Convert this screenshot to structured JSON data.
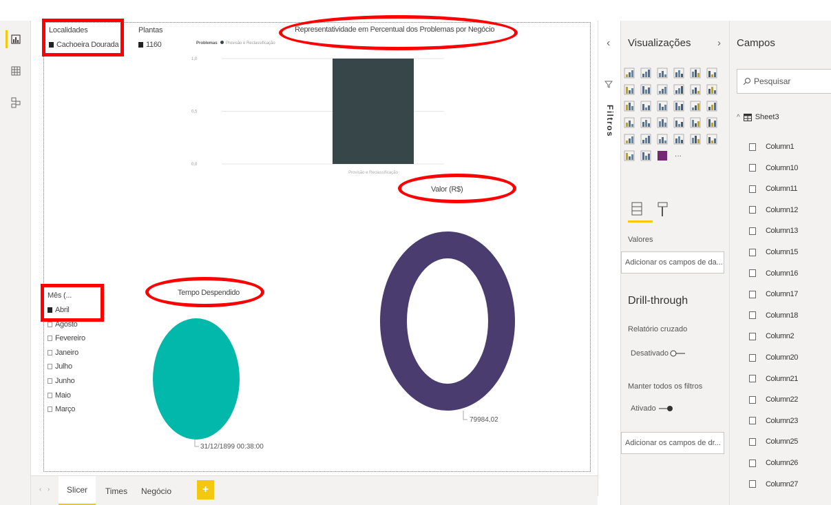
{
  "nav": {
    "icons": [
      "report-view-icon",
      "data-view-icon",
      "model-view-icon"
    ]
  },
  "canvas": {
    "slicer_localidades": {
      "title": "Localidades",
      "items": [
        {
          "label": "Cachoeira Dourada",
          "selected": true
        }
      ]
    },
    "slicer_plantas": {
      "title": "Plantas",
      "items": [
        {
          "label": "1160",
          "selected": true
        }
      ]
    },
    "slicer_mes": {
      "title": "Mês (...",
      "items": [
        {
          "label": "Abril",
          "selected": true
        },
        {
          "label": "Agosto",
          "selected": false
        },
        {
          "label": "Fevereiro",
          "selected": false
        },
        {
          "label": "Janeiro",
          "selected": false
        },
        {
          "label": "Julho",
          "selected": false
        },
        {
          "label": "Junho",
          "selected": false
        },
        {
          "label": "Maio",
          "selected": false
        },
        {
          "label": "Março",
          "selected": false
        }
      ]
    },
    "bar_title": "Representatividade em Percentual dos Problemas por Negócio",
    "donut_title": "Valor (R$)",
    "pie_title": "Tempo Despendido",
    "accent": "#ff0000"
  },
  "chart_data": [
    {
      "type": "bar",
      "title": "Representatividade em Percentual dos Problemas por Negócio",
      "legend_title": "Problemas",
      "legend": [
        "Provisão e Reclassificação"
      ],
      "categories": [
        "Provisão e Reclassificação"
      ],
      "series": [
        {
          "name": "Provisão e Reclassificação",
          "values": [
            1.0
          ],
          "color": "#374649"
        }
      ],
      "yticks": [
        "1,0",
        "0,5",
        "0,0"
      ],
      "ylim": [
        0,
        1
      ]
    },
    {
      "type": "pie",
      "title": "Tempo Despendido",
      "slices": [
        {
          "label": "31/12/1899 00:38:00",
          "value": 1,
          "color": "#01b8aa"
        }
      ]
    },
    {
      "type": "pie",
      "title": "Valor (R$)",
      "donut": true,
      "slices": [
        {
          "label": "79984,02",
          "value": 79984.02,
          "color": "#4a3c6e"
        }
      ]
    }
  ],
  "tabs": {
    "items": [
      "Slicer",
      "Times",
      "Negócio"
    ],
    "active": 0,
    "add": "+"
  },
  "filters": {
    "label": "Filtros",
    "collapse": "‹"
  },
  "viz_pane": {
    "title": "Visualizações",
    "chevron": "›",
    "more": "···",
    "values_label": "Valores",
    "values_placeholder": "Adicionar os campos de da...",
    "drill_title": "Drill-through",
    "cross_report_label": "Relatório cruzado",
    "cross_report_state": "Desativado",
    "keep_filters_label": "Manter todos os filtros",
    "keep_filters_state": "Ativado",
    "drill_placeholder": "Adicionar os campos de dr..."
  },
  "fields_pane": {
    "title": "Campos",
    "search_placeholder": "Pesquisar",
    "table_name": "Sheet3",
    "columns": [
      "Column1",
      "Column10",
      "Column11",
      "Column12",
      "Column13",
      "Column15",
      "Column16",
      "Column17",
      "Column18",
      "Column2",
      "Column20",
      "Column21",
      "Column22",
      "Column23",
      "Column25",
      "Column26",
      "Column27"
    ]
  }
}
